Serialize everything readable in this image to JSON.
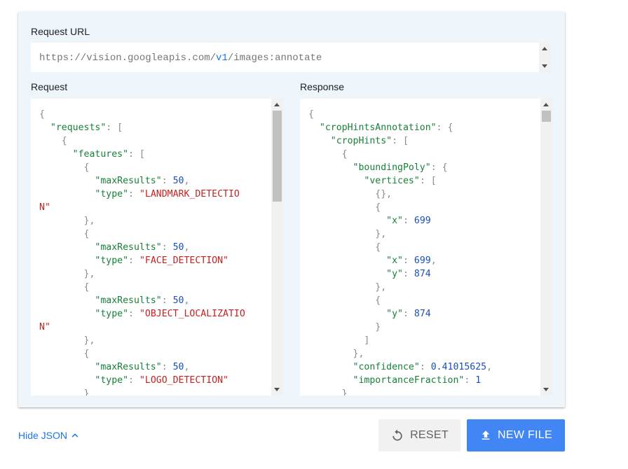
{
  "request_url": {
    "label": "Request URL",
    "prefix": "https://vision.googleapis.com/",
    "version": "v1",
    "suffix": "/images:annotate"
  },
  "request": {
    "label": "Request",
    "lines": [
      [
        [
          "p",
          "{"
        ]
      ],
      [
        [
          "p",
          "  "
        ],
        [
          "k",
          "\"requests\""
        ],
        [
          "p",
          ": ["
        ]
      ],
      [
        [
          "p",
          "    {"
        ]
      ],
      [
        [
          "p",
          "      "
        ],
        [
          "k",
          "\"features\""
        ],
        [
          "p",
          ": ["
        ]
      ],
      [
        [
          "p",
          "        {"
        ]
      ],
      [
        [
          "p",
          "          "
        ],
        [
          "k",
          "\"maxResults\""
        ],
        [
          "p",
          ": "
        ],
        [
          "n",
          "50"
        ],
        [
          "p",
          ","
        ]
      ],
      [
        [
          "p",
          "          "
        ],
        [
          "k",
          "\"type\""
        ],
        [
          "p",
          ": "
        ],
        [
          "s",
          "\"LANDMARK_DETECTIO"
        ]
      ],
      [
        [
          "s",
          "N\""
        ]
      ],
      [
        [
          "p",
          "        },"
        ]
      ],
      [
        [
          "p",
          "        {"
        ]
      ],
      [
        [
          "p",
          "          "
        ],
        [
          "k",
          "\"maxResults\""
        ],
        [
          "p",
          ": "
        ],
        [
          "n",
          "50"
        ],
        [
          "p",
          ","
        ]
      ],
      [
        [
          "p",
          "          "
        ],
        [
          "k",
          "\"type\""
        ],
        [
          "p",
          ": "
        ],
        [
          "s",
          "\"FACE_DETECTION\""
        ]
      ],
      [
        [
          "p",
          "        },"
        ]
      ],
      [
        [
          "p",
          "        {"
        ]
      ],
      [
        [
          "p",
          "          "
        ],
        [
          "k",
          "\"maxResults\""
        ],
        [
          "p",
          ": "
        ],
        [
          "n",
          "50"
        ],
        [
          "p",
          ","
        ]
      ],
      [
        [
          "p",
          "          "
        ],
        [
          "k",
          "\"type\""
        ],
        [
          "p",
          ": "
        ],
        [
          "s",
          "\"OBJECT_LOCALIZATIO"
        ]
      ],
      [
        [
          "s",
          "N\""
        ]
      ],
      [
        [
          "p",
          "        },"
        ]
      ],
      [
        [
          "p",
          "        {"
        ]
      ],
      [
        [
          "p",
          "          "
        ],
        [
          "k",
          "\"maxResults\""
        ],
        [
          "p",
          ": "
        ],
        [
          "n",
          "50"
        ],
        [
          "p",
          ","
        ]
      ],
      [
        [
          "p",
          "          "
        ],
        [
          "k",
          "\"type\""
        ],
        [
          "p",
          ": "
        ],
        [
          "s",
          "\"LOGO_DETECTION\""
        ]
      ],
      [
        [
          "p",
          "        }"
        ]
      ]
    ]
  },
  "response": {
    "label": "Response",
    "lines": [
      [
        [
          "p",
          "{"
        ]
      ],
      [
        [
          "p",
          "  "
        ],
        [
          "k",
          "\"cropHintsAnnotation\""
        ],
        [
          "p",
          ": {"
        ]
      ],
      [
        [
          "p",
          "    "
        ],
        [
          "k",
          "\"cropHints\""
        ],
        [
          "p",
          ": ["
        ]
      ],
      [
        [
          "p",
          "      {"
        ]
      ],
      [
        [
          "p",
          "        "
        ],
        [
          "k",
          "\"boundingPoly\""
        ],
        [
          "p",
          ": {"
        ]
      ],
      [
        [
          "p",
          "          "
        ],
        [
          "k",
          "\"vertices\""
        ],
        [
          "p",
          ": ["
        ]
      ],
      [
        [
          "p",
          "            {},"
        ]
      ],
      [
        [
          "p",
          "            {"
        ]
      ],
      [
        [
          "p",
          "              "
        ],
        [
          "k",
          "\"x\""
        ],
        [
          "p",
          ": "
        ],
        [
          "n",
          "699"
        ]
      ],
      [
        [
          "p",
          "            },"
        ]
      ],
      [
        [
          "p",
          "            {"
        ]
      ],
      [
        [
          "p",
          "              "
        ],
        [
          "k",
          "\"x\""
        ],
        [
          "p",
          ": "
        ],
        [
          "n",
          "699"
        ],
        [
          "p",
          ","
        ]
      ],
      [
        [
          "p",
          "              "
        ],
        [
          "k",
          "\"y\""
        ],
        [
          "p",
          ": "
        ],
        [
          "n",
          "874"
        ]
      ],
      [
        [
          "p",
          "            },"
        ]
      ],
      [
        [
          "p",
          "            {"
        ]
      ],
      [
        [
          "p",
          "              "
        ],
        [
          "k",
          "\"y\""
        ],
        [
          "p",
          ": "
        ],
        [
          "n",
          "874"
        ]
      ],
      [
        [
          "p",
          "            }"
        ]
      ],
      [
        [
          "p",
          "          ]"
        ]
      ],
      [
        [
          "p",
          "        },"
        ]
      ],
      [
        [
          "p",
          "        "
        ],
        [
          "k",
          "\"confidence\""
        ],
        [
          "p",
          ": "
        ],
        [
          "n",
          "0.41015625"
        ],
        [
          "p",
          ","
        ]
      ],
      [
        [
          "p",
          "        "
        ],
        [
          "k",
          "\"importanceFraction\""
        ],
        [
          "p",
          ": "
        ],
        [
          "n",
          "1"
        ]
      ],
      [
        [
          "p",
          "      }"
        ]
      ]
    ]
  },
  "footer": {
    "hide_json_label": "Hide JSON",
    "reset_label": "RESET",
    "new_file_label": "NEW FILE"
  },
  "icons": {
    "hide_json": "chevron-up-icon",
    "reset": "reset-icon",
    "new_file": "upload-icon"
  },
  "colors": {
    "card_bg": "#eef6fc",
    "accent": "#1a73e8",
    "primary_button": "#4285f4",
    "json_key": "#188038",
    "json_string": "#c5221f",
    "json_number": "#1a4fb8"
  }
}
